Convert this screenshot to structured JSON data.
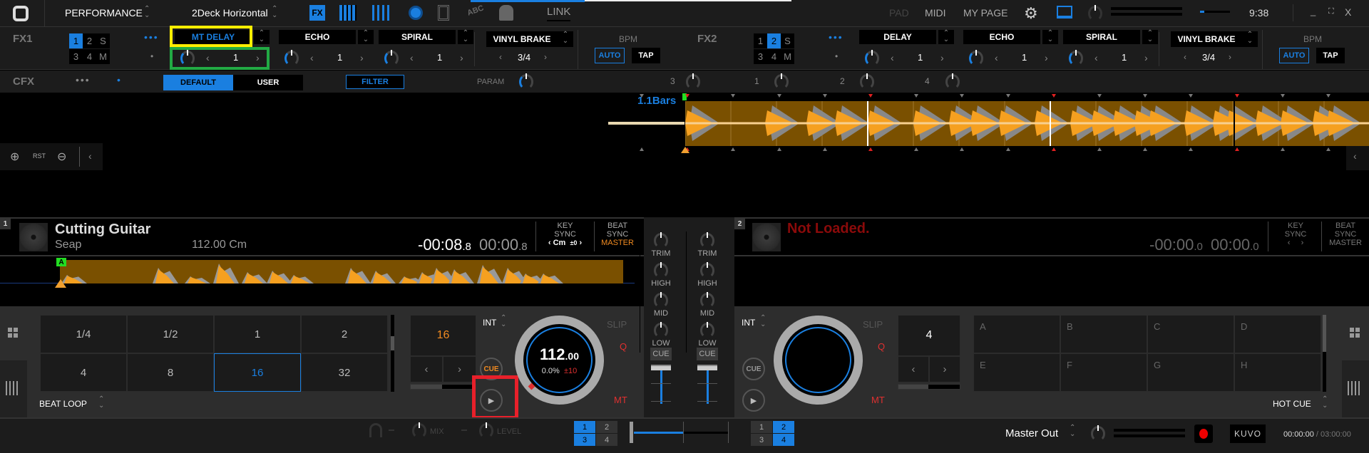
{
  "topbar": {
    "mode": "PERFORMANCE",
    "layout": "2Deck Horizontal",
    "link": "LINK",
    "pad": "PAD",
    "midi": "MIDI",
    "mypage": "MY PAGE",
    "clock": "9:38",
    "icons": [
      "fx-icon",
      "grid-icon",
      "mixer-icon",
      "record-icon",
      "video-icon",
      "lyric-icon",
      "camera-icon"
    ]
  },
  "fx": [
    {
      "label": "FX1",
      "assign": [
        "1",
        "2",
        "S",
        "3",
        "4",
        "M"
      ],
      "active": "1",
      "slots": [
        {
          "name": "MT DELAY",
          "value": "1",
          "active": true
        },
        {
          "name": "ECHO",
          "value": "1"
        },
        {
          "name": "SPIRAL",
          "value": "1"
        }
      ],
      "release": {
        "name": "VINYL BRAKE",
        "value": "3/4"
      },
      "bpm": {
        "label": "BPM",
        "auto": "AUTO",
        "tap": "TAP"
      }
    },
    {
      "label": "FX2",
      "assign": [
        "1",
        "2",
        "S",
        "3",
        "4",
        "M"
      ],
      "active": "2",
      "slots": [
        {
          "name": "DELAY",
          "value": "1"
        },
        {
          "name": "ECHO",
          "value": "1"
        },
        {
          "name": "SPIRAL",
          "value": "1"
        }
      ],
      "release": {
        "name": "VINYL BRAKE",
        "value": "3/4"
      },
      "bpm": {
        "label": "BPM",
        "auto": "AUTO",
        "tap": "TAP"
      }
    }
  ],
  "cfx": {
    "label": "CFX",
    "default": "DEFAULT",
    "user": "USER",
    "filter": "FILTER",
    "param": "PARAM",
    "channels": [
      "3",
      "1",
      "2",
      "4"
    ]
  },
  "waveform": {
    "bars": "1.1Bars",
    "zoom_reset": "RST"
  },
  "deck1": {
    "number": "1",
    "title": "Cutting Guitar",
    "artist": "Seap",
    "bpm_key": "112.00 Cm",
    "remain": "-00:08",
    "remain_frac": ".8",
    "elapsed": "00:00",
    "elapsed_frac": ".8",
    "key_sync": [
      "KEY",
      "SYNC"
    ],
    "key": "Cm",
    "key_shift": "±0",
    "beat_sync": [
      "BEAT",
      "SYNC"
    ],
    "master": "MASTER",
    "cue_marker": "A",
    "loop_pads": [
      "1/4",
      "1/2",
      "1",
      "2",
      "4",
      "8",
      "16",
      "32"
    ],
    "loop_active": "16",
    "loop_size": "16",
    "pad_mode": "BEAT LOOP",
    "int": "INT",
    "cue": "CUE",
    "jog_bpm": "112",
    "jog_bpm_frac": ".00",
    "pitch": "0.0%",
    "range": "±10",
    "slip": "SLIP",
    "q": "Q",
    "mt": "MT"
  },
  "deck2": {
    "number": "2",
    "title": "Not Loaded.",
    "remain": "-00:00",
    "remain_frac": ".0",
    "elapsed": "00:00",
    "elapsed_frac": ".0",
    "key_sync": [
      "KEY",
      "SYNC"
    ],
    "beat_sync": [
      "BEAT",
      "SYNC"
    ],
    "master": "MASTER",
    "hot_cues": [
      "A",
      "B",
      "C",
      "D",
      "E",
      "F",
      "G",
      "H"
    ],
    "loop_size": "4",
    "pad_mode": "HOT CUE",
    "int": "INT",
    "cue": "CUE",
    "slip": "SLIP",
    "q": "Q",
    "mt": "MT"
  },
  "mixer": {
    "eq": [
      "TRIM",
      "HIGH",
      "MID",
      "LOW"
    ],
    "cue": "CUE"
  },
  "bottom": {
    "mix": "MIX",
    "level": "LEVEL",
    "assign_left": [
      "1",
      "2",
      "3",
      "4"
    ],
    "assign_right": [
      "1",
      "2",
      "3",
      "4"
    ],
    "output": "Master Out",
    "kuvo": "KUVO",
    "rec_time": "00:00:00",
    "rec_sep": "/",
    "rec_max": "03:00:00"
  },
  "colors": {
    "accent": "#1a7fe0",
    "orange": "#f5a020",
    "waveform_bg": "#7a5000",
    "red": "#e03030"
  }
}
